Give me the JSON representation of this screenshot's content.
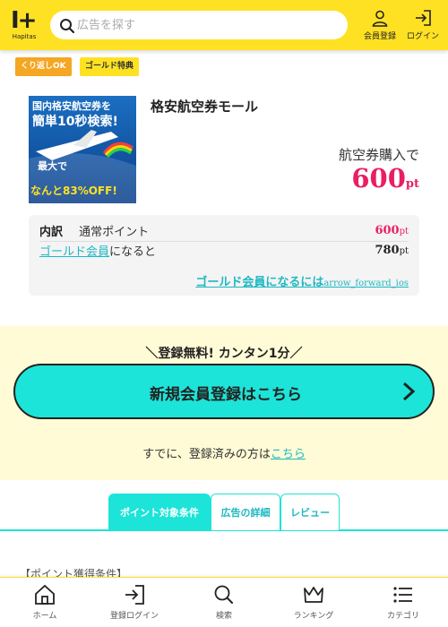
{
  "header": {
    "logo_text": "Hapitas",
    "search_placeholder": "広告を探す",
    "register_label": "会員登録",
    "login_label": "ログイン",
    "accent_color": "#ffe123"
  },
  "badges": [
    "くり返しOK",
    "ゴールド特典"
  ],
  "ad": {
    "banner_lines": [
      "国内格安航空券を",
      "簡単10秒検索!",
      "最大で",
      "なんと83%OFF!"
    ],
    "title": "格安航空券モール",
    "action_text": "航空券購入で",
    "points": "600",
    "points_unit": "pt"
  },
  "detail": {
    "breakdown_label": "内訳",
    "normal_label": "通常ポイント",
    "normal_value": "600",
    "gold_link": "ゴールド会員",
    "gold_suffix": "になると",
    "gold_value": "780",
    "unit": "pt",
    "how_to_gold": "ゴールド会員になるには",
    "how_to_gold_icon": "arrow_forward_ios"
  },
  "register": {
    "caption": "＼登録無料! カンタン1分／",
    "button_label": "新規会員登録はこちら",
    "login_prefix": "すでに、登録済みの方は",
    "login_link": "こちら",
    "button_color": "#1ce4d8"
  },
  "tabs": [
    "ポイント対象条件",
    "広告の詳細",
    "レビュー"
  ],
  "conditions_heading": "【ポイント獲得条件】",
  "bottom_nav": [
    "ホーム",
    "登録ログイン",
    "検索",
    "ランキング",
    "カテゴリ"
  ]
}
